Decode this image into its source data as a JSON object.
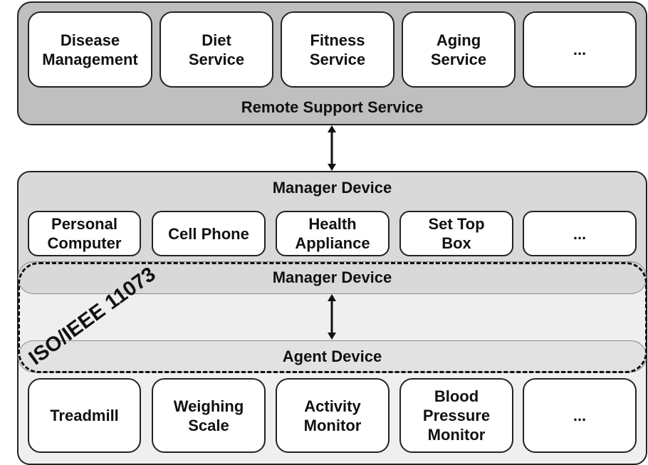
{
  "remote_support": {
    "title": "Remote Support Service",
    "services": [
      "Disease\nManagement",
      "Diet\nService",
      "Fitness\nService",
      "Aging\nService",
      "..."
    ]
  },
  "manager": {
    "title": "Manager Device",
    "devices": [
      "Personal\nComputer",
      "Cell Phone",
      "Health\nAppliance",
      "Set Top\nBox",
      "..."
    ]
  },
  "standard": {
    "label": "ISO/IEEE 11073",
    "manager_band": "Manager Device",
    "agent_band": "Agent Device"
  },
  "agent": {
    "devices": [
      "Treadmill",
      "Weighing\nScale",
      "Activity\nMonitor",
      "Blood\nPressure\nMonitor",
      "..."
    ]
  },
  "colors": {
    "remote_bg": "#bfbfbf",
    "manager_bg": "#d9d9d9",
    "inner_bg": "#efefef"
  }
}
